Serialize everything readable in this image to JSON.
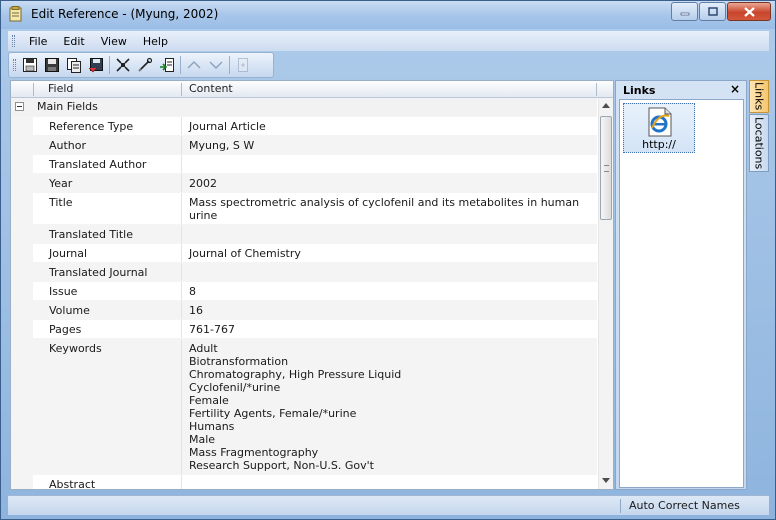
{
  "window": {
    "title": "Edit Reference - (Myung, 2002)"
  },
  "menu": [
    "File",
    "Edit",
    "View",
    "Help"
  ],
  "toolbar": {
    "icons": [
      "save-and-close-icon",
      "save-icon",
      "copy-reference-icon",
      "save-to-disk-icon",
      "collapse-fields-icon",
      "attach-link-icon",
      "find-full-text-icon",
      "previous-reference-icon",
      "next-reference-icon",
      "insert-icon"
    ]
  },
  "grid": {
    "header": {
      "field": "Field",
      "content": "Content"
    },
    "group": "Main Fields",
    "rows": [
      {
        "field": "Reference Type",
        "content": [
          "Journal Article"
        ]
      },
      {
        "field": "Author",
        "content": [
          "Myung, S W"
        ]
      },
      {
        "field": "Translated Author",
        "content": []
      },
      {
        "field": "Year",
        "content": [
          "2002"
        ]
      },
      {
        "field": "Title",
        "content": [
          "Mass spectrometric analysis of cyclofenil and its metabolites in human",
          "urine"
        ]
      },
      {
        "field": "Translated Title",
        "content": []
      },
      {
        "field": "Journal",
        "content": [
          "Journal of Chemistry"
        ]
      },
      {
        "field": "Translated Journal",
        "content": []
      },
      {
        "field": "Issue",
        "content": [
          "8"
        ]
      },
      {
        "field": "Volume",
        "content": [
          "16"
        ]
      },
      {
        "field": "Pages",
        "content": [
          "761-767"
        ]
      },
      {
        "field": "Keywords",
        "content": [
          "Adult",
          "Biotransformation",
          "Chromatography, High Pressure Liquid",
          "Cyclofenil/*urine",
          "Female",
          "Fertility Agents, Female/*urine",
          "Humans",
          "Male",
          "Mass Fragmentography",
          "Research Support, Non-U.S. Gov't"
        ]
      },
      {
        "field": "Abstract",
        "content": []
      }
    ]
  },
  "links_panel": {
    "title": "Links",
    "close": "×",
    "item_label": "http://"
  },
  "side_tabs": [
    "Links",
    "Locations"
  ],
  "status": {
    "text": "Auto Correct Names"
  },
  "colors": {
    "window_frame": "#8eb4de",
    "active_tab": "#f7c66c",
    "alt_row": "#f4f4f4"
  }
}
